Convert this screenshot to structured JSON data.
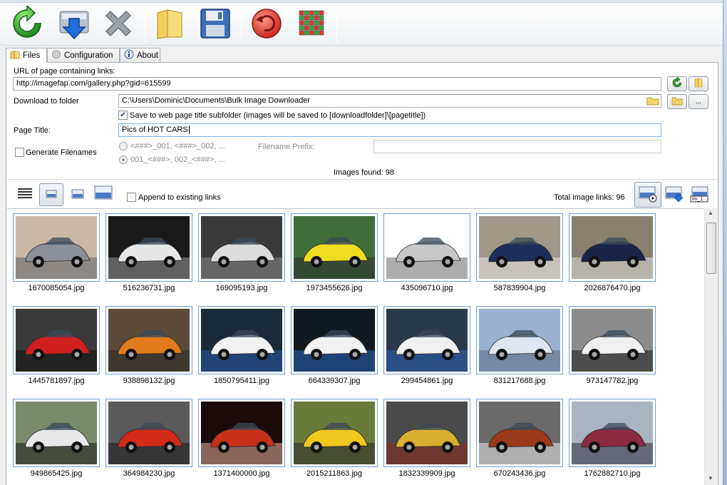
{
  "toolbar": {
    "icons": [
      "refresh-icon",
      "download-icon",
      "cancel-icon",
      "folder-icon",
      "save-icon",
      "undo-icon",
      "grid-icon"
    ]
  },
  "tabs": [
    {
      "label": "Files",
      "icon": "folder-icon",
      "active": true
    },
    {
      "label": "Configuration",
      "icon": "gear-icon",
      "active": false
    },
    {
      "label": "About",
      "icon": "info-icon",
      "active": false
    }
  ],
  "form": {
    "url_label": "URL of page containing links:",
    "url_value": "http://imagefap.com/gallery.php?gid=615599",
    "folder_label": "Download to folder",
    "folder_value": "C:\\Users\\Dominic\\Documents\\Bulk Image Downloader",
    "folder_browse_label": "...",
    "subfolder_checked": true,
    "subfolder_label": "Save to web page title subfolder (images will be saved to [downloadfolder]\\[pagetitle])",
    "title_label": "Page Title:",
    "title_value": "Pics of HOT CARS",
    "generate_label": "Generate Filenames",
    "generate_checked": false,
    "pattern1": "<###>_001, <###>_002, ...",
    "pattern2": "001_<###>, 002_<###>, ...",
    "prefix_label": "Filename Prefix:",
    "prefix_value": "",
    "images_found": "Images found: 98"
  },
  "viewbar": {
    "append_label": "Append to existing links",
    "append_checked": false,
    "total_links": "Total image links: 96",
    "thumbnail_tag": "im_1"
  },
  "thumbnails": [
    {
      "name": "1670085054.jpg",
      "colors": [
        "#c9b8a6",
        "#8a8f98",
        "#5b6068"
      ]
    },
    {
      "name": "516236731.jpg",
      "colors": [
        "#1a1a1a",
        "#e6e6e6",
        "#9a9a9a"
      ]
    },
    {
      "name": "169095193.jpg",
      "colors": [
        "#3a3a3a",
        "#dcdcdc",
        "#8a8a8a"
      ]
    },
    {
      "name": "1973455626.jpg",
      "colors": [
        "#3f6e3a",
        "#f0dc1e",
        "#2b2b2b"
      ]
    },
    {
      "name": "435096710.jpg",
      "colors": [
        "#ffffff",
        "#c8c8c8",
        "#6a6a6a"
      ]
    },
    {
      "name": "587839904.jpg",
      "colors": [
        "#a09888",
        "#1f2d5c",
        "#e8e8e8"
      ]
    },
    {
      "name": "2026876470.jpg",
      "colors": [
        "#8a8070",
        "#1a2448",
        "#dcdcdc"
      ]
    },
    {
      "name": "1445781897.jpg",
      "colors": [
        "#3a3a3a",
        "#d01e1e",
        "#111111"
      ]
    },
    {
      "name": "938898132.jpg",
      "colors": [
        "#5a4a3a",
        "#e07a1a",
        "#2a2a2a"
      ]
    },
    {
      "name": "1850795411.jpg",
      "colors": [
        "#1a2a3a",
        "#f2f2f2",
        "#2a5aa8"
      ]
    },
    {
      "name": "664339307.jpg",
      "colors": [
        "#101820",
        "#f2f2f2",
        "#2a6ac0"
      ]
    },
    {
      "name": "299454861.jpg",
      "colors": [
        "#2a3a4a",
        "#f0f0f0",
        "#2a60b8"
      ]
    },
    {
      "name": "831217688.jpg",
      "colors": [
        "#9ab0d0",
        "#dfe6f0",
        "#5a6a80"
      ]
    },
    {
      "name": "973147782.jpg",
      "colors": [
        "#8c8c8c",
        "#f0f0f0",
        "#1a1a1a"
      ]
    },
    {
      "name": "949865425.jpg",
      "colors": [
        "#7a8a6a",
        "#e8e8e8",
        "#1a1a1a"
      ]
    },
    {
      "name": "364984230.jpg",
      "colors": [
        "#5a5a5a",
        "#d42a1a",
        "#1a1a1a"
      ]
    },
    {
      "name": "1371400000.jpg",
      "colors": [
        "#1a0a0a",
        "#c8301a",
        "#e8b0a0"
      ]
    },
    {
      "name": "2015211863.jpg",
      "colors": [
        "#6a7a3a",
        "#f0c81e",
        "#2a2a2a"
      ]
    },
    {
      "name": "1832339909.jpg",
      "colors": [
        "#4a4a4a",
        "#d8b030",
        "#8a2a1a"
      ]
    },
    {
      "name": "670243436.jpg",
      "colors": [
        "#6a6a6a",
        "#9a3a1a",
        "#e8e8e8"
      ]
    },
    {
      "name": "1762882710.jpg",
      "colors": [
        "#aab4c0",
        "#8a2a40",
        "#2a2a3a"
      ]
    }
  ]
}
